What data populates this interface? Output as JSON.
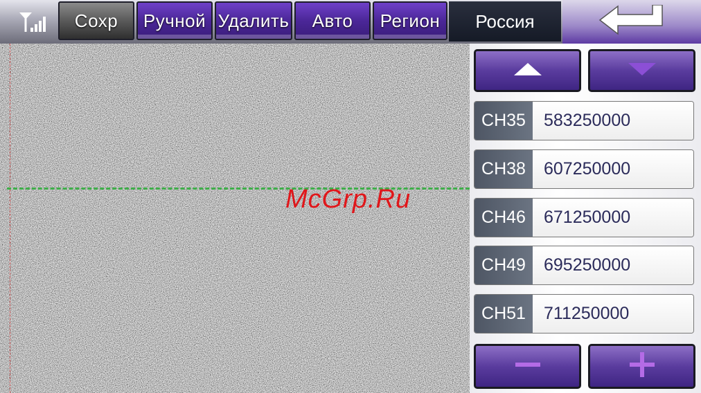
{
  "toolbar": {
    "save_label": "Сохр",
    "manual_label": "Ручной",
    "delete_label": "Удалить",
    "auto_label": "Авто",
    "region_label": "Регион",
    "region_value": "Россия",
    "signal_icon": "signal-strength-icon",
    "back_icon": "back-arrow-icon"
  },
  "video": {
    "watermark": "McGrp.Ru"
  },
  "channels": [
    {
      "name": "CH35",
      "freq": "583250000"
    },
    {
      "name": "CH38",
      "freq": "607250000"
    },
    {
      "name": "CH46",
      "freq": "671250000"
    },
    {
      "name": "CH49",
      "freq": "695250000"
    },
    {
      "name": "CH51",
      "freq": "711250000"
    }
  ],
  "controls": {
    "up_icon": "triangle-up-icon",
    "down_icon": "chevron-down-icon",
    "minus_icon": "minus-icon",
    "plus_icon": "plus-icon"
  },
  "colors": {
    "accent_purple": "#4b2798",
    "frequency_text": "#2b2b5a",
    "watermark": "#e0171b"
  }
}
